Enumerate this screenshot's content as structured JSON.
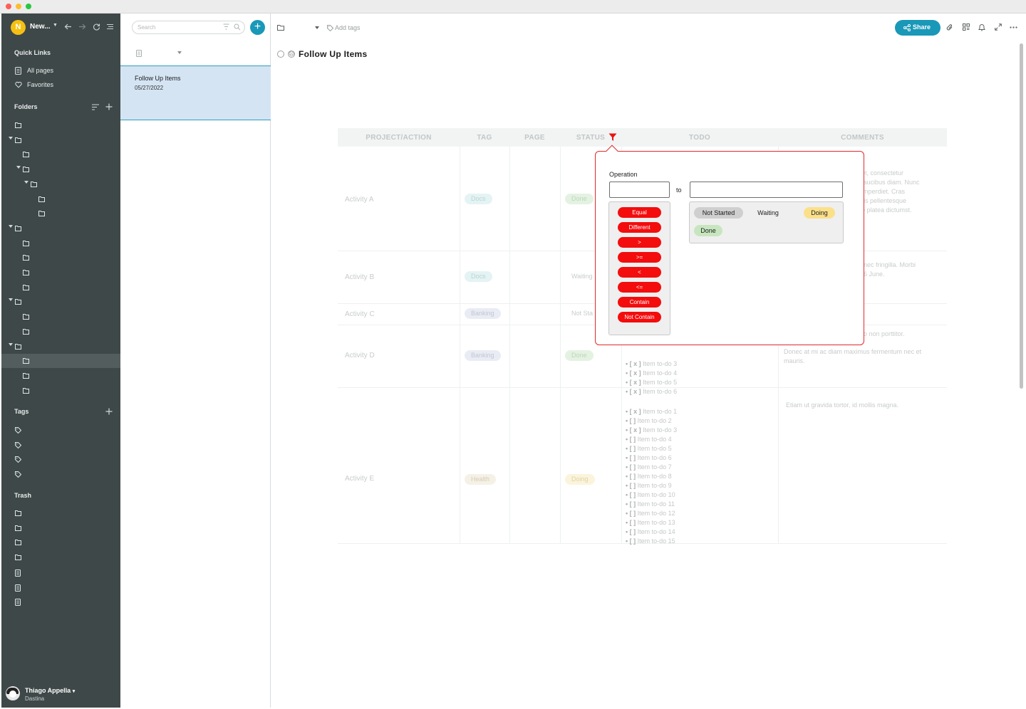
{
  "workspace": {
    "initial": "N",
    "name": "New..."
  },
  "sidebar": {
    "quick_links_title": "Quick Links",
    "quick_links": [
      {
        "label": "All pages",
        "icon": "page-icon"
      },
      {
        "label": "Favorites",
        "icon": "heart-icon"
      }
    ],
    "folders_title": "Folders",
    "tags_title": "Tags",
    "trash_title": "Trash"
  },
  "user": {
    "name": "Thiago Appella",
    "subtitle": "Dastina"
  },
  "search": {
    "placeholder": "Search"
  },
  "note_list": [
    {
      "title": "Follow Up Items",
      "date": "05/27/2022"
    }
  ],
  "toolbar": {
    "add_tags": "Add tags",
    "share": "Share"
  },
  "page": {
    "title": "Follow Up Items"
  },
  "table": {
    "columns": [
      "PROJECT/ACTION",
      "TAG",
      "PAGE",
      "STATUS",
      "TODO",
      "COMMENTS"
    ],
    "rows": [
      {
        "action": "Activity A",
        "tag": "Docs",
        "status": "Done",
        "comment": "et, consectetur\nfaucibus diam. Nunc\nimperdiet. Cras\nris pellentesque\ne platea dictumst."
      },
      {
        "action": "Activity B",
        "tag": "Docs",
        "status": "Waiting",
        "comment": "nec fringilla. Morbi\n6 June."
      },
      {
        "action": "Activity C",
        "tag": "Banking",
        "status": "Not Sta",
        "comment": ""
      },
      {
        "action": "Activity D",
        "tag": "Banking",
        "status": "Done",
        "comment_top": "o non porttitor.",
        "comment": "Donec at mi ac diam maximus fermentum nec et\nmauris."
      },
      {
        "action": "Activity E",
        "tag": "Health",
        "status": "Doing",
        "comment": "Etiam ut gravida tortor, id mollis magna."
      }
    ],
    "todos_d": [
      {
        "mark": "[ x ]",
        "text": "Item to-do 3"
      },
      {
        "mark": "[ x ]",
        "text": "Item to-do 4"
      },
      {
        "mark": "[ x ]",
        "text": "Item to-do 5"
      },
      {
        "mark": "[ x ]",
        "text": "Item to-do 6"
      }
    ],
    "todos_e": [
      {
        "mark": "[ x ]",
        "text": "Item to-do 1"
      },
      {
        "mark": "[   ]",
        "text": "Item to-do 2"
      },
      {
        "mark": "[ x ]",
        "text": "Item to-do 3"
      },
      {
        "mark": "[   ]",
        "text": "Item to-do 4"
      },
      {
        "mark": "[   ]",
        "text": "Item to-do 5"
      },
      {
        "mark": "[   ]",
        "text": "Item to-do 6"
      },
      {
        "mark": "[   ]",
        "text": "Item to-do 7"
      },
      {
        "mark": "[   ]",
        "text": "Item to-do 8"
      },
      {
        "mark": "[   ]",
        "text": "Item to-do 9"
      },
      {
        "mark": "[   ]",
        "text": "Item to-do 10"
      },
      {
        "mark": "[   ]",
        "text": "Item to-do 11"
      },
      {
        "mark": "[   ]",
        "text": "Item to-do 12"
      },
      {
        "mark": "[   ]",
        "text": "Item to-do 13"
      },
      {
        "mark": "[   ]",
        "text": "Item to-do 14"
      },
      {
        "mark": "[   ]",
        "text": "Item to-do 15"
      }
    ]
  },
  "filter_popup": {
    "operation_label": "Operation",
    "to_label": "to",
    "operations": [
      "Equal",
      "Different",
      ">",
      ">=",
      "<",
      "<=",
      "Contain",
      "Not Contain"
    ],
    "values": [
      "Not Started",
      "Waiting",
      "Doing",
      "Done"
    ]
  },
  "colors": {
    "sidebar_bg": "#3f4848",
    "accent": "#1a98b8",
    "filter_red": "#f30d0d",
    "selected_note_bg": "#d4e4f3"
  }
}
